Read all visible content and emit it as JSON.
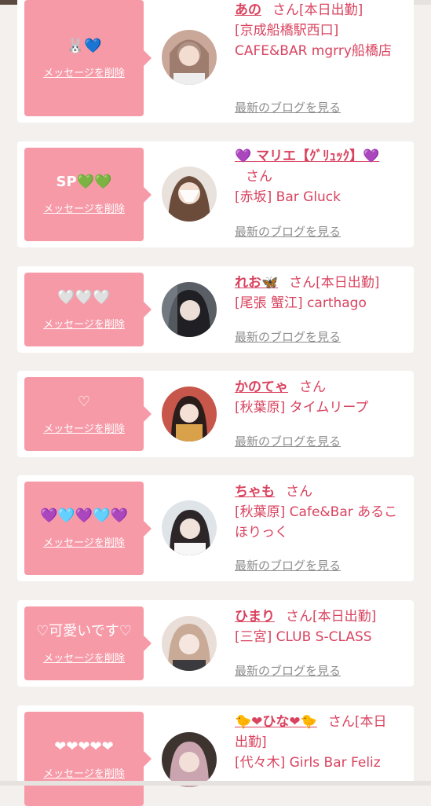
{
  "common": {
    "honorific": "さん",
    "delete_label": "メッセージを削除",
    "blog_label": "最新のブログを見る"
  },
  "cards": [
    {
      "message": "🐰💙",
      "name": "あの",
      "suffix": "[本日出勤]",
      "shop": "[京成船橋駅西口] CAFE&BAR mgrry船橋店"
    },
    {
      "message": "SP💚💚",
      "name": "💜 マリエ【ｸﾞﾘｭｯｸ】💜",
      "suffix": "",
      "shop": "[赤坂] Bar Gluck"
    },
    {
      "message": "🤍🤍🤍",
      "name": "れお🦋",
      "suffix": "[本日出勤]",
      "shop": "[尾張 蟹江] carthago"
    },
    {
      "message": "♡",
      "name": "かのてゃ",
      "suffix": "",
      "shop": "[秋葉原] タイムリープ"
    },
    {
      "message": "💜🩵💜🩵💜",
      "name": "ちゃも",
      "suffix": "",
      "shop": "[秋葉原] Cafe&Bar あるこほりっく"
    },
    {
      "message": "♡可愛いです♡",
      "name": "ひまり",
      "suffix": "[本日出勤]",
      "shop": "[三宮] CLUB S-CLASS"
    },
    {
      "message": "❤❤❤❤❤",
      "name": "🐤❤ひな❤🐤",
      "suffix": "[本日出勤]",
      "shop": "[代々木] Girls Bar Feliz"
    }
  ],
  "colors": {
    "bubble": "#f79aa8",
    "name_text": "#d9435f",
    "blog_link": "#8d8d8d",
    "background": "#f3f0ee"
  }
}
